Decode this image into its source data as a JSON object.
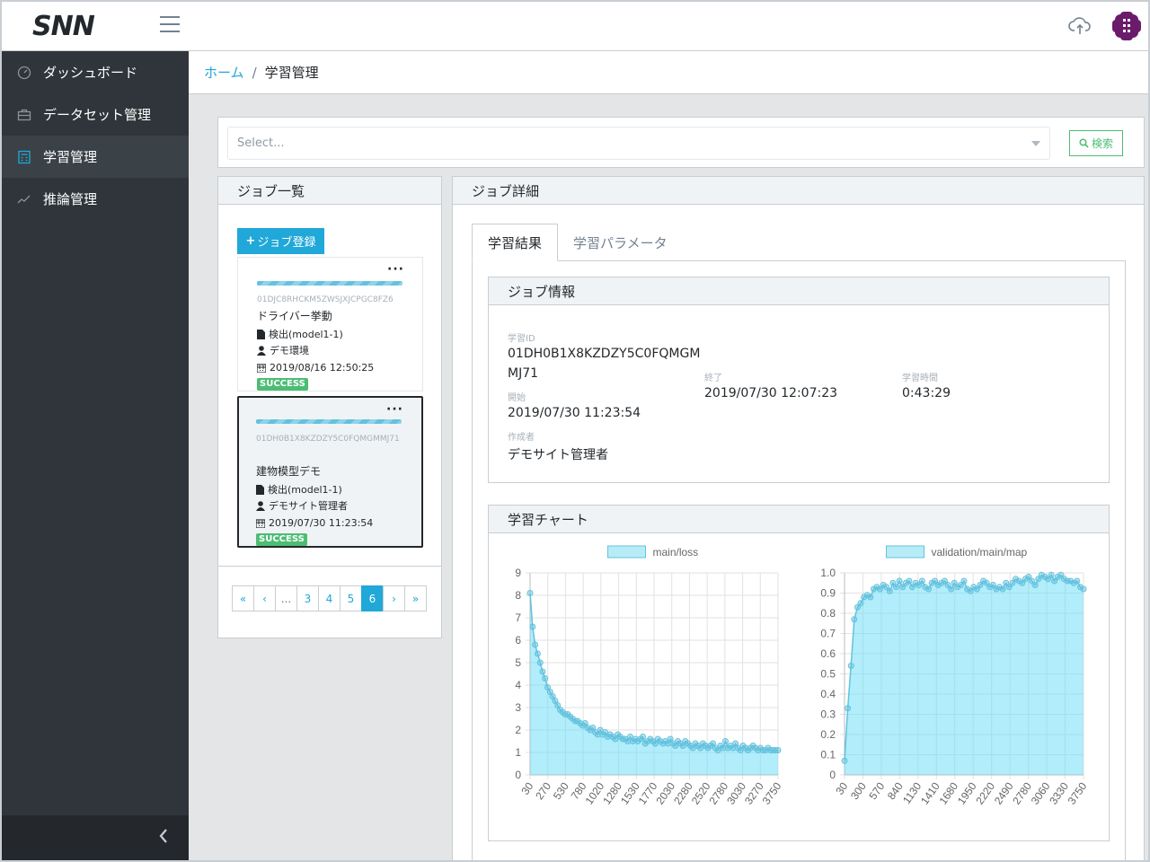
{
  "header": {
    "logo_text": "SNN",
    "logo_icon": "snn-logo",
    "menu_icon": "hamburger-icon",
    "upload_icon": "cloud-upload-icon",
    "avatar_icon": "org-avatar-icon"
  },
  "sidebar": {
    "items": [
      {
        "label": "ダッシュボード",
        "icon": "speedometer-icon"
      },
      {
        "label": "データセット管理",
        "icon": "briefcase-icon"
      },
      {
        "label": "学習管理",
        "icon": "calculator-icon",
        "active": true
      },
      {
        "label": "推論管理",
        "icon": "trend-icon"
      }
    ],
    "collapse_icon": "chevron-left-icon"
  },
  "breadcrumb": {
    "home": "ホーム",
    "separator": "/",
    "current": "学習管理"
  },
  "search": {
    "placeholder": "Select...",
    "button_label": "検索"
  },
  "job_list": {
    "title": "ジョブ一覧",
    "add_button": "ジョブ登録",
    "items": [
      {
        "id": "01DJC8RHCKM5ZWSJXJCPGC8FZ6",
        "name": "ドライバー挙動",
        "model": "検出(model1-1)",
        "env": "デモ環境",
        "date": "2019/08/16 12:50:25",
        "status": "SUCCESS"
      },
      {
        "id": "01DH0B1X8KZDZY5C0FQMGMMJ71",
        "name": "建物模型デモ",
        "model": "検出(model1-1)",
        "env": "デモサイト管理者",
        "date": "2019/07/30 11:23:54",
        "status": "SUCCESS",
        "selected": true
      }
    ],
    "pagination": {
      "first": "«",
      "prev": "‹",
      "ellipsis": "...",
      "pages": [
        "3",
        "4",
        "5",
        "6"
      ],
      "current": "6",
      "next": "›",
      "last": "»"
    }
  },
  "job_detail": {
    "title": "ジョブ詳細",
    "tabs": [
      "学習結果",
      "学習パラメータ"
    ],
    "active_tab": "学習結果",
    "info": {
      "title": "ジョブ情報",
      "learning_id_label": "学習ID",
      "learning_id_line1": "01DH0B1X8KZDZY5C0FQMGM",
      "learning_id_line2": "MJ71",
      "start_label": "開始",
      "start_value": "2019/07/30 11:23:54",
      "author_label": "作成者",
      "author_value": "デモサイト管理者",
      "end_label": "終了",
      "end_value": "2019/07/30 12:07:23",
      "duration_label": "学習時間",
      "duration_value": "0:43:29"
    },
    "chart_title": "学習チャート"
  },
  "chart_data": [
    {
      "type": "area",
      "legend": "main/loss",
      "color": "#63c2de",
      "ylim": [
        0,
        9
      ],
      "yticks": [
        "0",
        "1",
        "2",
        "3",
        "4",
        "5",
        "6",
        "7",
        "8",
        "9"
      ],
      "xticks": [
        "30",
        "270",
        "530",
        "780",
        "1020",
        "1280",
        "1530",
        "1770",
        "2030",
        "2280",
        "2520",
        "2780",
        "3030",
        "3270",
        "3750"
      ],
      "values": [
        8.1,
        6.6,
        5.8,
        5.4,
        5.0,
        4.6,
        4.3,
        3.9,
        3.7,
        3.5,
        3.3,
        3.1,
        2.9,
        2.8,
        2.7,
        2.7,
        2.6,
        2.5,
        2.4,
        2.4,
        2.3,
        2.2,
        2.3,
        2.1,
        2.0,
        2.1,
        1.9,
        1.8,
        2.0,
        1.8,
        1.9,
        1.7,
        1.8,
        1.7,
        1.6,
        1.8,
        1.7,
        1.6,
        1.6,
        1.5,
        1.7,
        1.5,
        1.6,
        1.5,
        1.6,
        1.7,
        1.4,
        1.5,
        1.6,
        1.5,
        1.4,
        1.6,
        1.5,
        1.4,
        1.5,
        1.4,
        1.6,
        1.4,
        1.3,
        1.5,
        1.4,
        1.3,
        1.5,
        1.4,
        1.3,
        1.2,
        1.4,
        1.3,
        1.2,
        1.4,
        1.3,
        1.2,
        1.3,
        1.4,
        1.2,
        1.1,
        1.3,
        1.2,
        1.5,
        1.2,
        1.3,
        1.2,
        1.4,
        1.2,
        1.1,
        1.3,
        1.2,
        1.1,
        1.2,
        1.3,
        1.2,
        1.1,
        1.2,
        1.1,
        1.1,
        1.2,
        1.1,
        1.1,
        1.1,
        1.1
      ]
    },
    {
      "type": "area",
      "legend": "validation/main/map",
      "color": "#63c2de",
      "ylim": [
        0,
        1.0
      ],
      "yticks": [
        "0",
        "0.1",
        "0.2",
        "0.3",
        "0.4",
        "0.5",
        "0.6",
        "0.7",
        "0.8",
        "0.9",
        "1.0"
      ],
      "xticks": [
        "30",
        "300",
        "570",
        "840",
        "1130",
        "1410",
        "1680",
        "1950",
        "2220",
        "2490",
        "2780",
        "3060",
        "3330",
        "3750"
      ],
      "values": [
        0.07,
        0.33,
        0.54,
        0.77,
        0.83,
        0.85,
        0.88,
        0.89,
        0.88,
        0.92,
        0.93,
        0.92,
        0.94,
        0.93,
        0.91,
        0.95,
        0.93,
        0.96,
        0.93,
        0.95,
        0.96,
        0.93,
        0.95,
        0.94,
        0.96,
        0.93,
        0.92,
        0.95,
        0.96,
        0.94,
        0.95,
        0.96,
        0.94,
        0.92,
        0.95,
        0.93,
        0.94,
        0.96,
        0.92,
        0.91,
        0.93,
        0.92,
        0.94,
        0.96,
        0.95,
        0.93,
        0.94,
        0.92,
        0.93,
        0.92,
        0.95,
        0.93,
        0.95,
        0.97,
        0.96,
        0.95,
        0.97,
        0.98,
        0.96,
        0.94,
        0.97,
        0.99,
        0.98,
        0.97,
        0.99,
        0.96,
        0.98,
        0.99,
        0.97,
        0.96,
        0.96,
        0.95,
        0.96,
        0.93,
        0.92
      ]
    }
  ]
}
